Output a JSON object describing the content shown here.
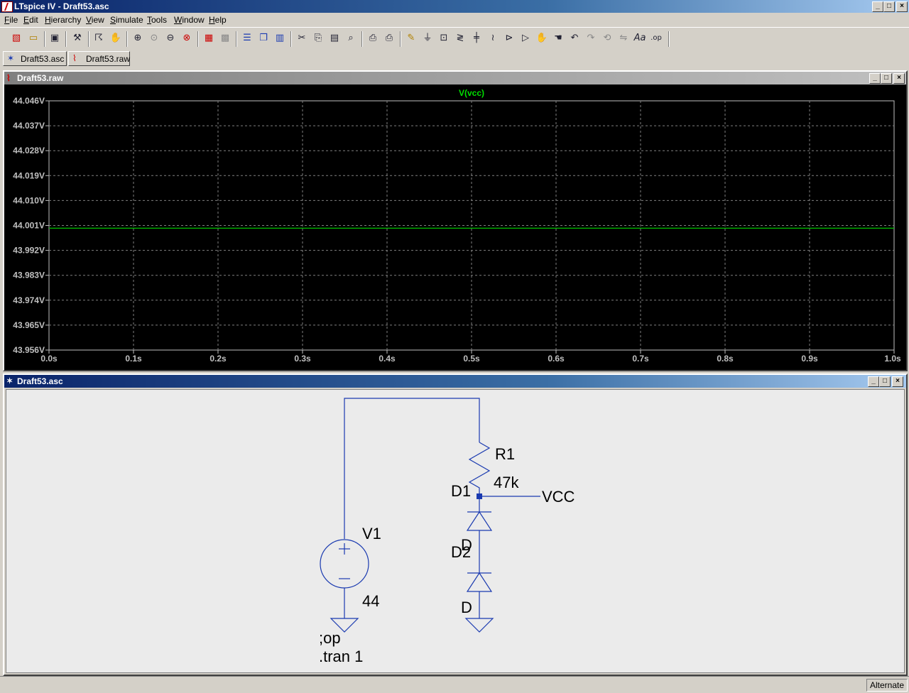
{
  "app": {
    "title": "LTspice IV - Draft53.asc",
    "window_controls": [
      "_",
      "□",
      "×"
    ]
  },
  "menu": [
    "File",
    "Edit",
    "Hierarchy",
    "View",
    "Simulate",
    "Tools",
    "Window",
    "Help"
  ],
  "toolbar_icons": [
    "new-schematic-icon",
    "open-icon",
    "save-icon",
    "control-panel-icon",
    "run-icon",
    "halt-icon",
    "zoom-in-icon",
    "zoom-pan-icon",
    "zoom-out-icon",
    "zoom-fit-icon",
    "autorange-icon",
    "grid-icon",
    "tile-horizontal-icon",
    "cascade-icon",
    "tile-vertical-icon",
    "cut-icon",
    "copy-icon",
    "paste-icon",
    "find-icon",
    "print-setup-icon",
    "print-icon",
    "wire-icon",
    "ground-icon",
    "label-net-icon",
    "resistor-icon",
    "capacitor-icon",
    "inductor-icon",
    "diode-icon",
    "component-icon",
    "move-icon",
    "drag-icon",
    "undo-icon",
    "redo-icon",
    "rotate-icon",
    "mirror-icon",
    "text-icon",
    "spice-directive-icon"
  ],
  "tabs": [
    {
      "label": "Draft53.asc",
      "icon": "schematic-icon"
    },
    {
      "label": "Draft53.raw",
      "icon": "waveform-icon"
    }
  ],
  "plot_window": {
    "title": "Draft53.raw",
    "trace_label": "V(vcc)",
    "trace_color": "#00c000"
  },
  "chart_data": {
    "type": "line",
    "series": [
      {
        "name": "V(vcc)",
        "x": [
          0.0,
          1.0
        ],
        "y": [
          44.0,
          44.0
        ],
        "color": "#00c000"
      }
    ],
    "xlim": [
      0.0,
      1.0
    ],
    "ylim": [
      43.956,
      44.046
    ],
    "xticks": [
      "0.0s",
      "0.1s",
      "0.2s",
      "0.3s",
      "0.4s",
      "0.5s",
      "0.6s",
      "0.7s",
      "0.8s",
      "0.9s",
      "1.0s"
    ],
    "yticks": [
      "44.046V",
      "44.037V",
      "44.028V",
      "44.019V",
      "44.010V",
      "44.001V",
      "43.992V",
      "43.983V",
      "43.974V",
      "43.965V",
      "43.956V"
    ],
    "grid": true,
    "background": "#000000",
    "grid_color": "#808080"
  },
  "schematic_window": {
    "title": "Draft53.asc",
    "wire_color": "#1a3ab0",
    "labels": {
      "r1_name": "R1",
      "r1_value": "47k",
      "net_label": "VCC",
      "d1_name": "D1",
      "d1_model": "D",
      "d2_name": "D2",
      "d2_model": "D",
      "v1_name": "V1",
      "v1_value": "44",
      "directive_op": ";op",
      "directive_tran": ".tran 1"
    }
  },
  "status": {
    "mode": "Alternate"
  }
}
